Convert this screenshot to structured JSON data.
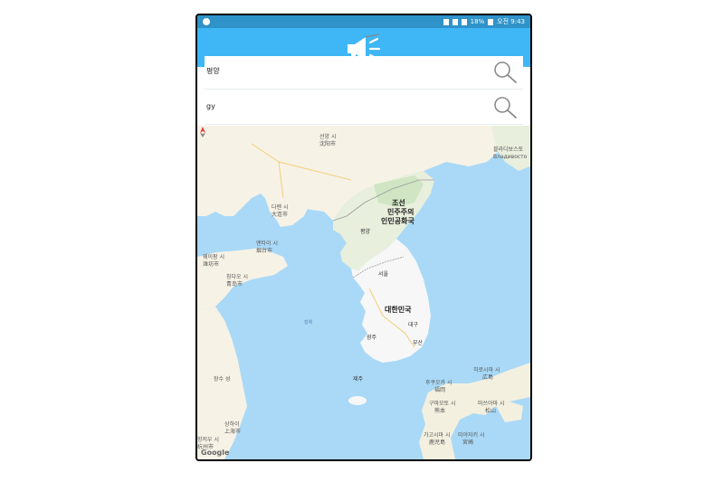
{
  "statusbar": {
    "battery": "18%",
    "time": "오전 9:43"
  },
  "search": [
    {
      "value": "평양",
      "placeholder": ""
    },
    {
      "value": "gy",
      "placeholder": ""
    }
  ],
  "map": {
    "labels": {
      "north_korea_1": "조선",
      "north_korea_2": "민주주의",
      "north_korea_3": "인민공화국",
      "south_korea": "대한민국",
      "pyongyang": "평양",
      "seoul": "서울",
      "daegu": "대구",
      "gwangju": "광주",
      "busan": "부산",
      "jeju": "제주",
      "shenyang": "선양 시",
      "shenyang_cn": "沈阳市",
      "dalian": "다롄 시",
      "dalian_cn": "大连市",
      "yantai": "옌타이 시",
      "yantai_cn": "烟台市",
      "weifang": "웨이팡 시",
      "weifang_cn": "潍坊市",
      "qingdao": "칭다오 시",
      "qingdao_cn": "青岛市",
      "shanghai": "상하이",
      "shanghai_cn": "上海市",
      "hangzhou": "항저우 시",
      "hangzhou_cn": "杭州市",
      "vladivostok": "블라디보스토",
      "vladivostok_ru": "Владивосто",
      "fukuoka": "후쿠오카 시",
      "fukuoka_jp": "福岡",
      "kumamoto": "구마모토 시",
      "kumamoto_jp": "熊本",
      "kagoshima": "가고시마 시",
      "kagoshima_jp": "鹿児島",
      "hiroshima": "히로시마 시",
      "hiroshima_jp": "広島",
      "matsuyama": "마쓰야마 시",
      "matsuyama_jp": "松山",
      "miyazaki": "미야자키 시",
      "miyazaki_jp": "宮崎",
      "yellow_sea": "황해",
      "jiangsu": "장수 성",
      "google": "Google"
    }
  }
}
